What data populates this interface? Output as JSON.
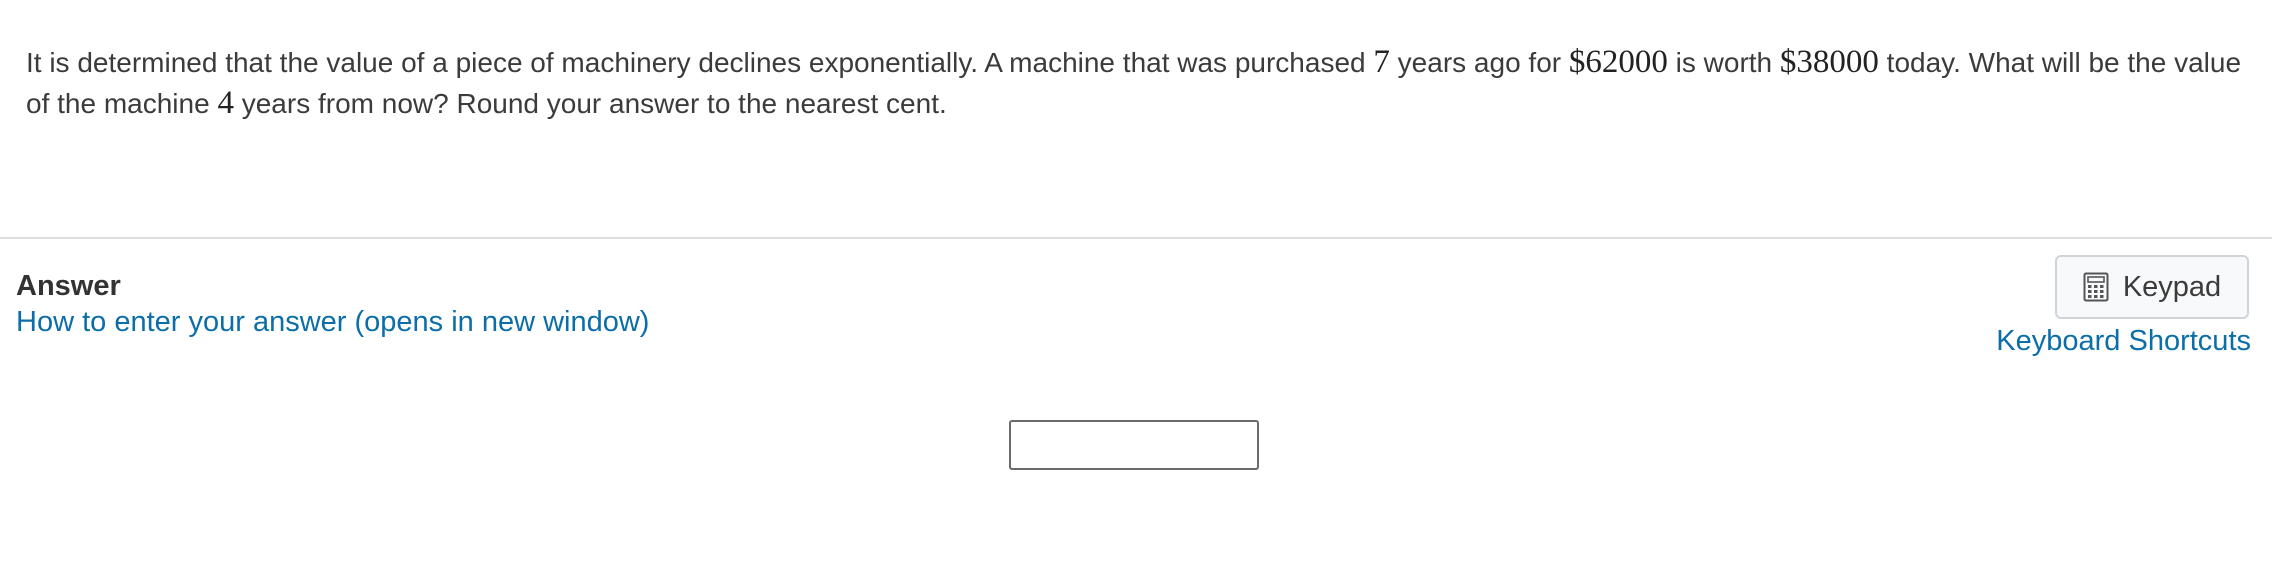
{
  "question": {
    "part1": "It is determined that the value of a piece of machinery declines exponentially.  A machine that was purchased ",
    "years_ago": "7",
    "part2": " years ago for ",
    "purchase_price": "$62000",
    "part3": " is worth ",
    "current_value": "$38000",
    "part4": " today.  What will be the value of the machine ",
    "years_from_now": "4",
    "part5": " years from now?  Round your answer to the nearest cent."
  },
  "answer": {
    "heading": "Answer",
    "help_link": "How to enter your answer (opens in new window)",
    "input_value": "",
    "input_placeholder": ""
  },
  "toolbar": {
    "keypad_label": "Keypad",
    "keypad_icon": "calculator-icon",
    "shortcuts_label": "Keyboard Shortcuts"
  },
  "colors": {
    "link": "#0b6ea8",
    "text": "#3b3b3b",
    "divider": "#dedede"
  }
}
